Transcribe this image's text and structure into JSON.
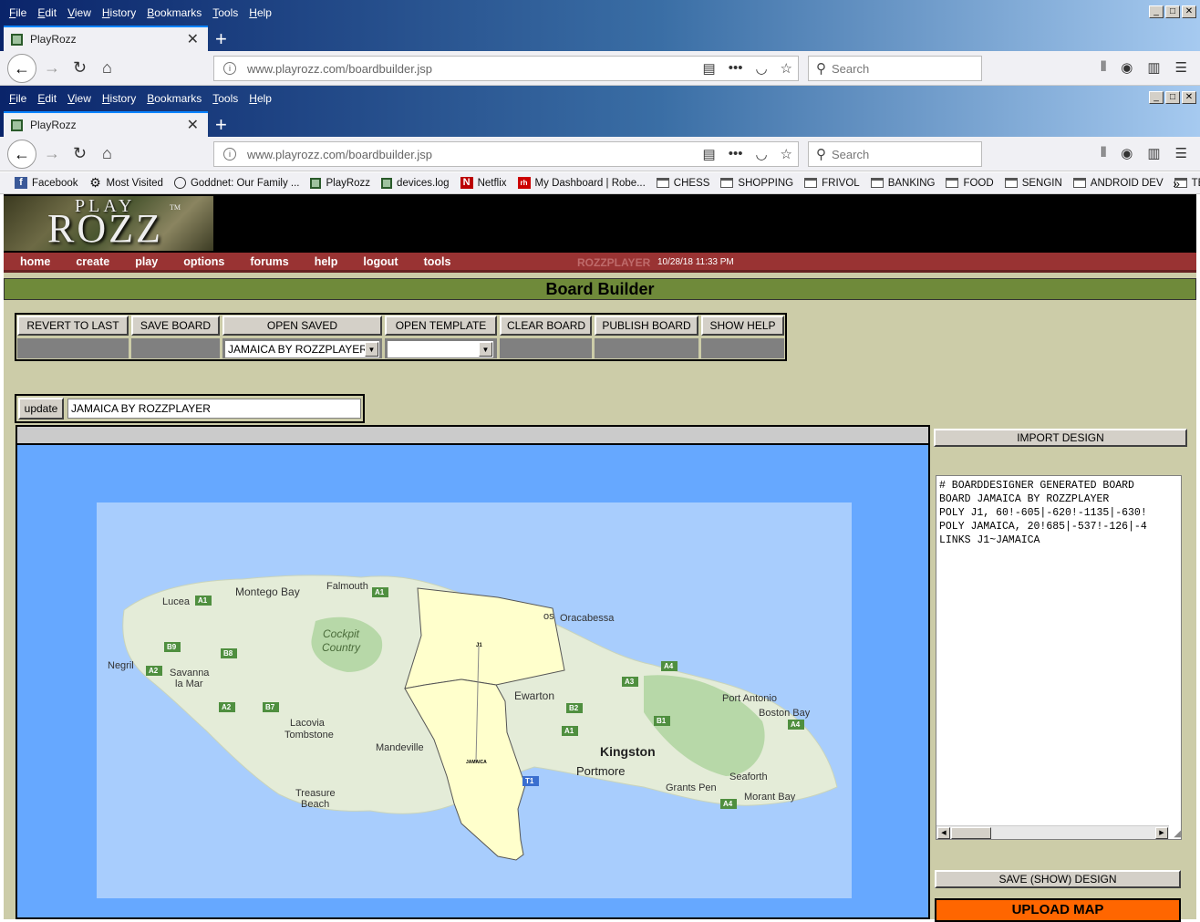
{
  "outer_window": {
    "menu": [
      "File",
      "Edit",
      "View",
      "History",
      "Bookmarks",
      "Tools",
      "Help"
    ],
    "tab_title": "PlayRozz",
    "url_host": "www.playrozz.com",
    "url_path": "/boardbuilder.jsp",
    "search_placeholder": "Search"
  },
  "inner_window": {
    "menu": [
      "File",
      "Edit",
      "View",
      "History",
      "Bookmarks",
      "Tools",
      "Help"
    ],
    "tab_title": "PlayRozz",
    "url_host": "www.playrozz.com",
    "url_path": "/boardbuilder.jsp",
    "search_placeholder": "Search"
  },
  "bookmarks": [
    {
      "label": "Facebook",
      "icon": "facebook-icon"
    },
    {
      "label": "Most Visited",
      "icon": "gear-icon"
    },
    {
      "label": "Goddnet: Our Family ...",
      "icon": "globe-icon"
    },
    {
      "label": "PlayRozz",
      "icon": "playrozz-icon"
    },
    {
      "label": "devices.log",
      "icon": "playrozz-icon"
    },
    {
      "label": "Netflix",
      "icon": "netflix-icon"
    },
    {
      "label": "My Dashboard | Robe...",
      "icon": "rh-icon"
    },
    {
      "label": "CHESS",
      "icon": "folder-icon"
    },
    {
      "label": "SHOPPING",
      "icon": "folder-icon"
    },
    {
      "label": "FRIVOL",
      "icon": "folder-icon"
    },
    {
      "label": "BANKING",
      "icon": "folder-icon"
    },
    {
      "label": "FOOD",
      "icon": "folder-icon"
    },
    {
      "label": "SENGIN",
      "icon": "folder-icon"
    },
    {
      "label": "ANDROID DEV",
      "icon": "folder-icon"
    },
    {
      "label": "TECH",
      "icon": "folder-icon"
    }
  ],
  "logo": {
    "line1": "PLAY",
    "line2": "ROZZ",
    "tm": "TM"
  },
  "nav": {
    "items": [
      "home",
      "create",
      "play",
      "options",
      "forums",
      "help",
      "logout",
      "tools"
    ],
    "user": "ROZZPLAYER",
    "timestamp": "10/28/18 11:33 PM"
  },
  "page_title": "Board Builder",
  "toolbar": {
    "revert": "REVERT TO LAST",
    "save_board": "SAVE BOARD",
    "open_saved": "OPEN SAVED",
    "open_template": "OPEN TEMPLATE",
    "clear_board": "CLEAR BOARD",
    "publish_board": "PUBLISH BOARD",
    "show_help": "SHOW HELP",
    "open_saved_value": "JAMAICA BY ROZZPLAYER",
    "open_template_value": ""
  },
  "update": {
    "button": "update",
    "value": "JAMAICA BY ROZZPLAYER"
  },
  "map": {
    "labels": {
      "montego_bay": "Montego Bay",
      "falmouth": "Falmouth",
      "lucea": "Lucea",
      "cockpit": "Cockpit",
      "country": "Country",
      "negril": "Negril",
      "savanna": "Savanna",
      "la_mar": "la Mar",
      "lacovia": "Lacovia",
      "tombstone": "Tombstone",
      "mandeville": "Mandeville",
      "treasure": "Treasure",
      "beach": "Beach",
      "ewarton": "Ewarton",
      "kingston": "Kingston",
      "portmore": "Portmore",
      "grants_pen": "Grants Pen",
      "seaforth": "Seaforth",
      "morant_bay": "Morant Bay",
      "port_antonio": "Port Antonio",
      "boston_bay": "Boston Bay",
      "oracabessa": "Oracabessa",
      "os": "os"
    },
    "territories": [
      {
        "name": "J1"
      },
      {
        "name": "JAMAICA"
      }
    ],
    "roads": [
      "A1",
      "A1",
      "B9",
      "B8",
      "A2",
      "A2",
      "B7",
      "A3",
      "A4",
      "B2",
      "A1",
      "B1",
      "A4",
      "T1",
      "A4"
    ]
  },
  "side": {
    "import": "IMPORT DESIGN",
    "design_text": "# BOARDDESIGNER GENERATED BOARD\nBOARD JAMAICA BY ROZZPLAYER\nPOLY J1, 60!-605|-620!-1135|-630!\nPOLY JAMAICA, 20!685|-537!-126|-4\nLINKS J1~JAMAICA",
    "save_show": "SAVE (SHOW) DESIGN",
    "upload": "UPLOAD MAP"
  }
}
